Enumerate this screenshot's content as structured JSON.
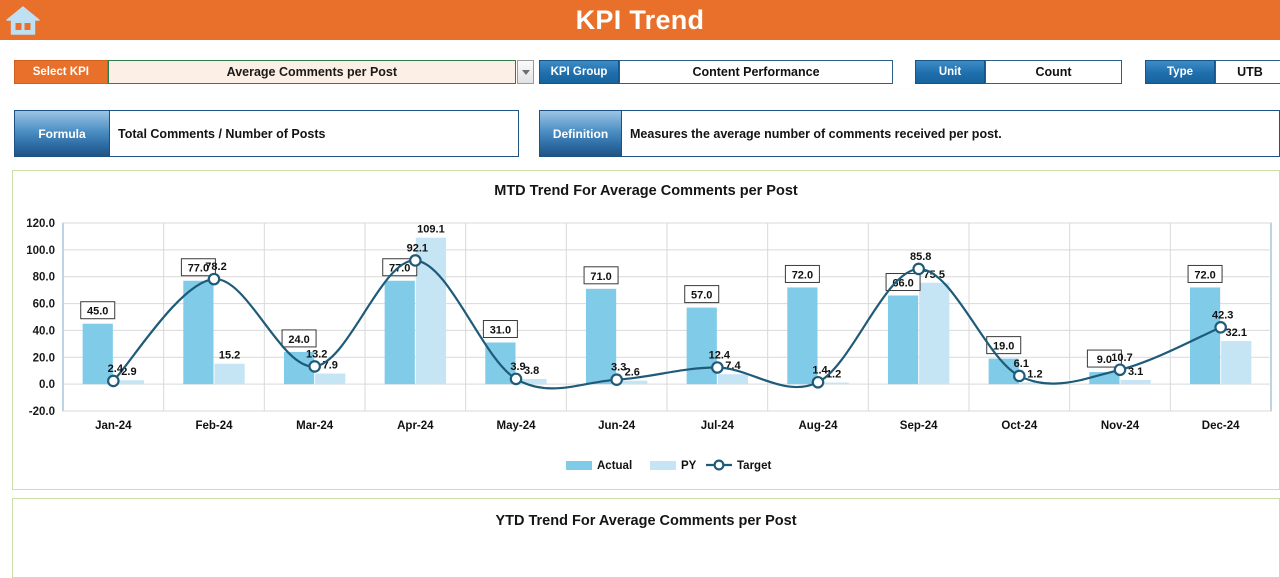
{
  "header": {
    "title": "KPI Trend",
    "home_icon": "home-icon",
    "bar_color": "#E8702A"
  },
  "controls": {
    "select_kpi_label": "Select KPI",
    "select_kpi_value": "Average Comments per Post",
    "dropdown_icon": "chevron-down-icon",
    "kpi_group_label": "KPI Group",
    "kpi_group_value": "Content Performance",
    "unit_label": "Unit",
    "unit_value": "Count",
    "type_label": "Type",
    "type_value": "UTB"
  },
  "meta": {
    "formula_label": "Formula",
    "formula_value": "Total Comments / Number of Posts",
    "definition_label": "Definition",
    "definition_value": "Measures the average number of comments received per post."
  },
  "ytd": {
    "title": "YTD Trend For Average Comments per Post"
  },
  "colors": {
    "accent_orange": "#E8702A",
    "accent_blue": "#2E6DA4",
    "actual_bar": "#7FCBE8",
    "py_bar": "#C5E5F5",
    "target_line": "#1F5B78",
    "panel_border": "#CBE0A8"
  },
  "chart_data": {
    "type": "bar",
    "title": "MTD Trend For Average Comments per Post",
    "xlabel": "",
    "ylabel": "",
    "ylim": [
      -20.0,
      120.0
    ],
    "ytick_step": 20.0,
    "yticks": [
      "120.0",
      "100.0",
      "80.0",
      "60.0",
      "40.0",
      "20.0",
      "0.0",
      "-20.0"
    ],
    "grid": true,
    "legend_position": "bottom",
    "categories": [
      "Jan-24",
      "Feb-24",
      "Mar-24",
      "Apr-24",
      "May-24",
      "Jun-24",
      "Jul-24",
      "Aug-24",
      "Sep-24",
      "Oct-24",
      "Nov-24",
      "Dec-24"
    ],
    "series": [
      {
        "name": "Actual",
        "kind": "bar",
        "color": "#7FCBE8",
        "values": [
          45.0,
          77.0,
          24.0,
          77.0,
          31.0,
          71.0,
          57.0,
          72.0,
          66.0,
          19.0,
          9.0,
          72.0
        ],
        "labels": [
          "45.0",
          "77.0",
          "24.0",
          "77.0",
          "31.0",
          "71.0",
          "57.0",
          "72.0",
          "66.0",
          "19.0",
          "9.0",
          "72.0"
        ]
      },
      {
        "name": "PY",
        "kind": "bar",
        "color": "#C5E5F5",
        "values": [
          2.9,
          15.2,
          7.9,
          109.1,
          3.8,
          2.6,
          7.4,
          1.2,
          75.5,
          1.2,
          3.1,
          32.1
        ],
        "labels": [
          "2.9",
          "15.2",
          "7.9",
          "109.1",
          "3.8",
          "2.6",
          "7.4",
          "1.2",
          "75.5",
          "1.2",
          "3.1",
          "32.1"
        ]
      },
      {
        "name": "Target",
        "kind": "line",
        "color": "#1F5B78",
        "values": [
          2.4,
          78.2,
          13.2,
          92.1,
          3.9,
          3.3,
          12.4,
          1.4,
          85.8,
          6.1,
          10.7,
          42.3
        ],
        "labels": [
          "2.4",
          "78.2",
          "13.2",
          "92.1",
          "3.9",
          "3.3",
          "12.4",
          "1.4",
          "85.8",
          "6.1",
          "10.7",
          "42.3"
        ]
      }
    ],
    "legend": [
      "Actual",
      "PY",
      "Target"
    ]
  }
}
